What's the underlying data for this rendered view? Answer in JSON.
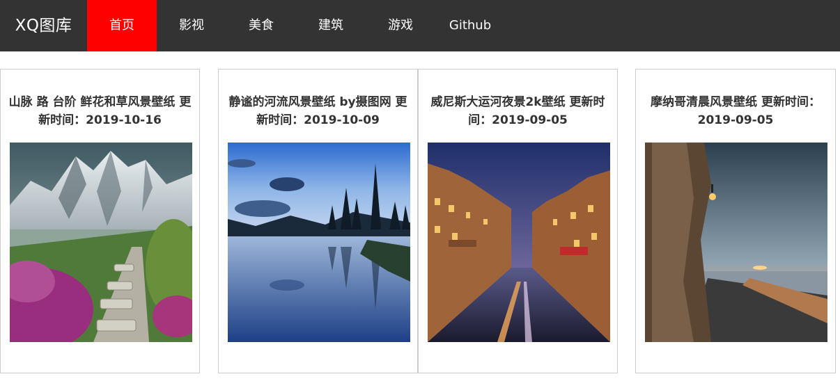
{
  "navbar": {
    "brand": "XQ图库",
    "items": [
      {
        "label": "首页",
        "active": true
      },
      {
        "label": "影视",
        "active": false
      },
      {
        "label": "美食",
        "active": false
      },
      {
        "label": "建筑",
        "active": false
      },
      {
        "label": "游戏",
        "active": false
      },
      {
        "label": "Github",
        "active": false
      }
    ],
    "colors": {
      "background": "#333333",
      "active": "#ff0000",
      "text": "#ffffff"
    }
  },
  "cards": [
    {
      "title": "山脉 路 台阶 鲜花和草风景壁纸 更新时间：2019-10-16",
      "image": "mountain-flower-path-photo"
    },
    {
      "title": "静谧的河流风景壁纸 by摄图网 更新时间：2019-10-09",
      "image": "calm-river-photo"
    },
    {
      "title": "威尼斯大运河夜景2k壁纸 更新时间：2019-09-05",
      "image": "venice-canal-night-photo"
    },
    {
      "title": "摩纳哥清晨风景壁纸 更新时间：2019-09-05",
      "image": "monaco-morning-photo"
    }
  ]
}
